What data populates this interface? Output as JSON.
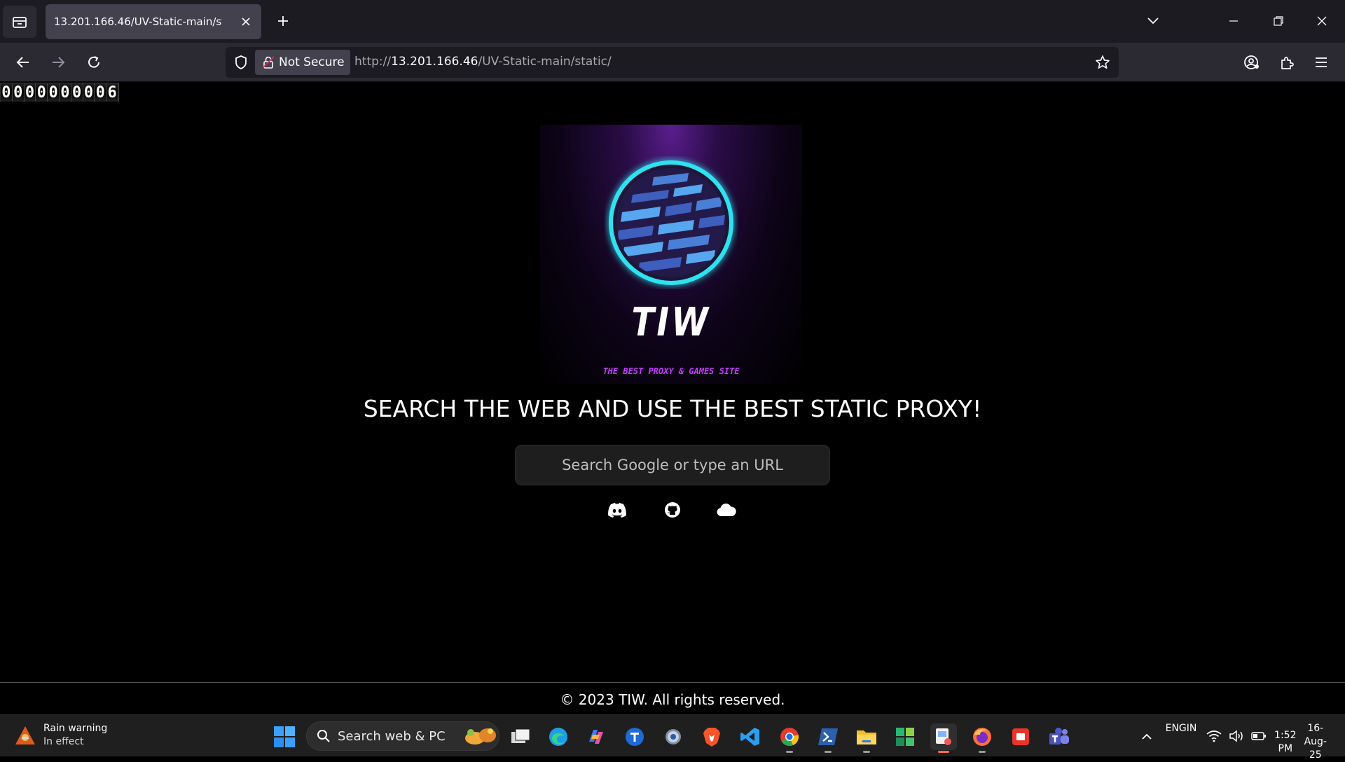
{
  "browser": {
    "tab_title": "13.201.166.46/UV-Static-main/static/",
    "security_label": "Not Secure",
    "url_scheme": "http://",
    "url_host": "13.201.166.46",
    "url_path": "/UV-Static-main/static/"
  },
  "page": {
    "hit_counter": [
      "0",
      "0",
      "0",
      "0",
      "0",
      "0",
      "0",
      "0",
      "0",
      "6"
    ],
    "logo_title": "TIW",
    "logo_subtitle": "THE BEST PROXY & GAMES SITE",
    "headline": "SEARCH THE WEB AND USE THE BEST STATIC PROXY!",
    "search_placeholder": "Search Google or type an URL",
    "social_links": [
      "discord-icon",
      "github-icon",
      "cloud-icon"
    ],
    "footer": "© 2023 TIW. All rights reserved."
  },
  "taskbar": {
    "weather_title": "Rain warning",
    "weather_status": "In effect",
    "search_label": "Search web & PC",
    "language": "ENG",
    "region": "IN",
    "time": "1:52 PM",
    "date": "16-Aug-25"
  },
  "colors": {
    "accent_cyan": "#2de2f0",
    "accent_purple": "#c43cff",
    "background": "#000000"
  }
}
